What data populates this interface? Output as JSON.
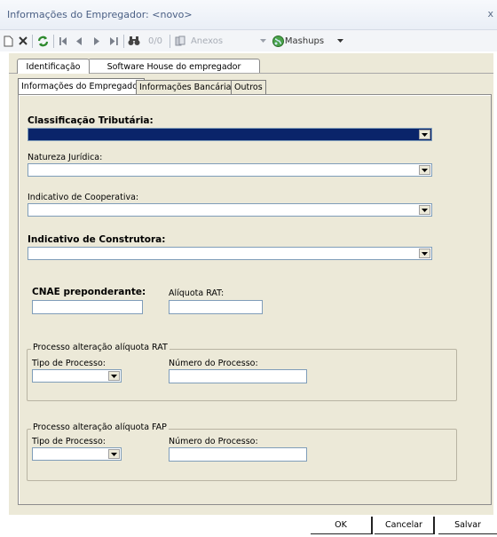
{
  "window": {
    "title": "Informações do Empregador: <novo>",
    "close": "x"
  },
  "toolbar": {
    "nav_count": "0/0",
    "attachments_label": "Anexos",
    "mashups_label": "Mashups"
  },
  "tabs": {
    "top": [
      {
        "label": "Identificação"
      },
      {
        "label": "Software House do empregador"
      }
    ],
    "sub": [
      {
        "label": "Informações do Empregador"
      },
      {
        "label": "Informações Bancárias"
      },
      {
        "label": "Outros"
      }
    ]
  },
  "form": {
    "classificacao_label": "Classificação Tributária:",
    "natureza_label": "Natureza Jurídica:",
    "cooperativa_label": "Indicativo de Cooperativa:",
    "construtora_label": "Indicativo de Construtora:",
    "cnae_label": "CNAE preponderante:",
    "aliquota_label": "Alíquota RAT:",
    "group_rat": {
      "legend": "Processo alteração alíquota RAT",
      "tipo_label": "Tipo de Processo:",
      "numero_label": "Número do Processo:"
    },
    "group_fap": {
      "legend": "Processo alteração alíquota FAP",
      "tipo_label": "Tipo de Processo:",
      "numero_label": "Número do Processo:"
    }
  },
  "buttons": {
    "ok": "OK",
    "cancel": "Cancelar",
    "save": "Salvar"
  },
  "colors": {
    "selected_combo": "#0a246a",
    "panel": "#ece9d8",
    "title_text": "#4a5f84"
  }
}
